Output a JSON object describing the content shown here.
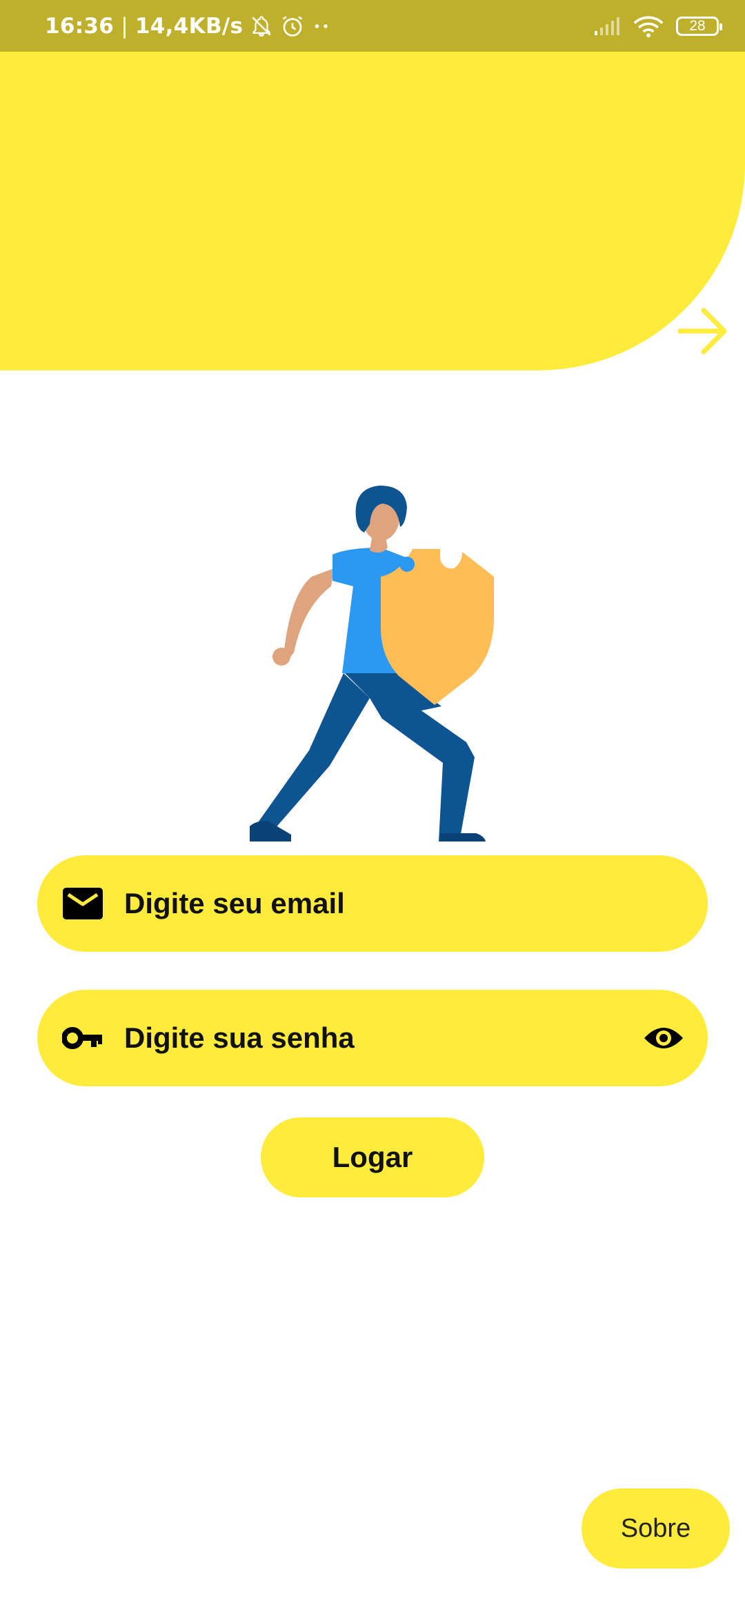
{
  "status_bar": {
    "time": "16:36",
    "separator": "|",
    "network_speed": "14,4KB/s",
    "battery": "28",
    "icons": [
      "notifications-off-icon",
      "alarm-icon",
      "more-dots-icon",
      "signal-icon",
      "wifi-icon",
      "battery-icon"
    ]
  },
  "header": {
    "next_icon": "arrow-right-icon"
  },
  "hero": {
    "illustration": "person-with-shield-illustration"
  },
  "form": {
    "email": {
      "placeholder": "Digite seu email",
      "icon": "email-icon"
    },
    "password": {
      "placeholder": "Digite sua senha",
      "icon": "key-icon",
      "toggle_icon": "eye-icon"
    },
    "login_label": "Logar"
  },
  "footer": {
    "about_label": "Sobre"
  },
  "colors": {
    "status_bar": "#BFB02C",
    "accent": "#FFEB3B",
    "text": "#111111",
    "background": "#FFFFFF"
  }
}
